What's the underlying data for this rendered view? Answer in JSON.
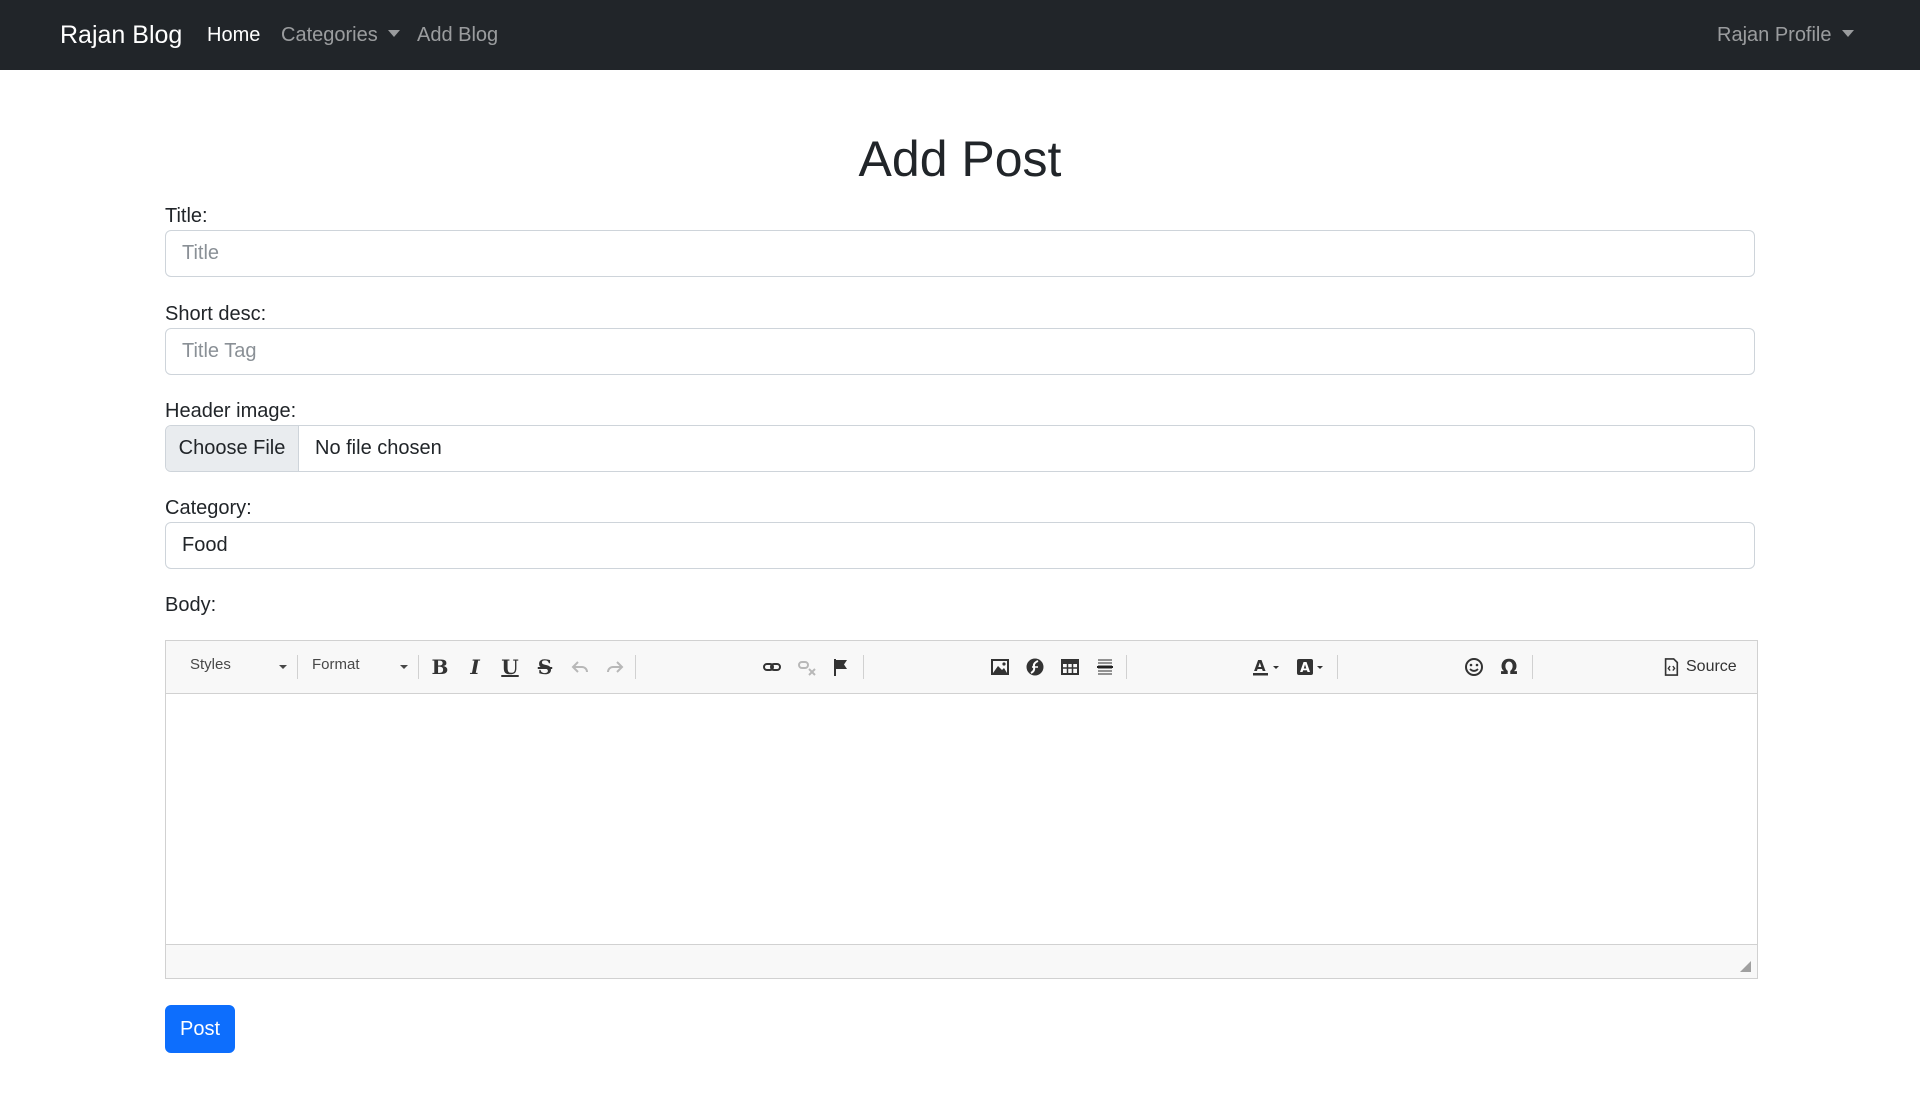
{
  "navbar": {
    "brand": "Rajan Blog",
    "links": {
      "home": "Home",
      "categories": "Categories",
      "add_blog": "Add Blog"
    },
    "profile": "Rajan Profile"
  },
  "page": {
    "title": "Add Post"
  },
  "form": {
    "title": {
      "label": "Title:",
      "placeholder": "Title",
      "value": ""
    },
    "short_desc": {
      "label": "Short desc:",
      "placeholder": "Title Tag",
      "value": ""
    },
    "header_image": {
      "label": "Header image:",
      "button": "Choose File",
      "status": "No file chosen"
    },
    "category": {
      "label": "Category:",
      "selected": "Food"
    },
    "body": {
      "label": "Body:"
    },
    "submit": "Post"
  },
  "editor": {
    "styles_combo": "Styles",
    "format_combo": "Format",
    "source_label": "Source",
    "toolbar_icons": [
      "bold-icon",
      "italic-icon",
      "underline-icon",
      "strikethrough-icon",
      "undo-icon",
      "redo-icon",
      "link-icon",
      "unlink-icon",
      "anchor-flag-icon",
      "image-icon",
      "flash-icon",
      "table-icon",
      "horizontal-rule-icon",
      "text-color-icon",
      "background-color-icon",
      "smiley-icon",
      "special-char-omega-icon",
      "source-icon"
    ]
  },
  "colors": {
    "navbar_bg": "#212529",
    "primary": "#0d6efd",
    "border": "#ced4da"
  }
}
